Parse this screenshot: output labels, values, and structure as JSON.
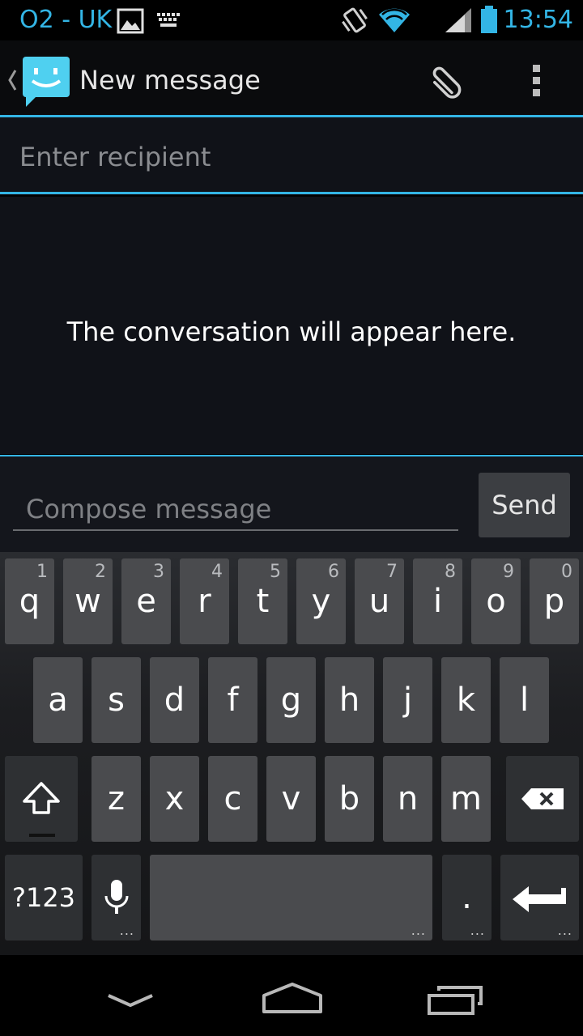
{
  "status_bar": {
    "carrier": "O2 - UK",
    "time": "13:54",
    "icons": [
      "image-notification-icon",
      "keyboard-notification-icon",
      "vibrate-icon",
      "wifi-icon",
      "signal-icon",
      "battery-icon"
    ],
    "accent": "#33b5e5"
  },
  "action_bar": {
    "title": "New message",
    "icons": [
      "back-icon",
      "messaging-app-icon",
      "attach-icon",
      "overflow-menu-icon"
    ]
  },
  "recipient": {
    "placeholder": "Enter recipient"
  },
  "conversation": {
    "empty_text": "The conversation will appear here."
  },
  "compose": {
    "placeholder": "Compose message",
    "send_label": "Send"
  },
  "keyboard": {
    "row1": [
      {
        "key": "q",
        "hint": "1"
      },
      {
        "key": "w",
        "hint": "2"
      },
      {
        "key": "e",
        "hint": "3"
      },
      {
        "key": "r",
        "hint": "4"
      },
      {
        "key": "t",
        "hint": "5"
      },
      {
        "key": "y",
        "hint": "6"
      },
      {
        "key": "u",
        "hint": "7"
      },
      {
        "key": "i",
        "hint": "8"
      },
      {
        "key": "o",
        "hint": "9"
      },
      {
        "key": "p",
        "hint": "0"
      }
    ],
    "row2": [
      "a",
      "s",
      "d",
      "f",
      "g",
      "h",
      "j",
      "k",
      "l"
    ],
    "row3": [
      "z",
      "x",
      "c",
      "v",
      "b",
      "n",
      "m"
    ],
    "symbols_label": "?123",
    "period_label": ".",
    "more_dots": "..."
  },
  "nav_bar": {
    "icons": [
      "back-nav-icon",
      "home-nav-icon",
      "recents-nav-icon"
    ]
  },
  "colors": {
    "accent": "#33b5e5",
    "background": "#101218",
    "key": "#4a4b4e",
    "key_dark": "#2e3033"
  }
}
